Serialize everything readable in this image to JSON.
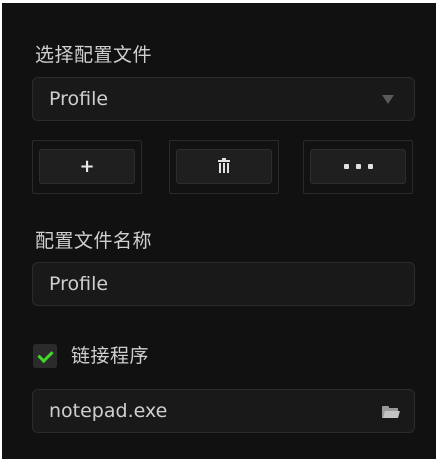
{
  "profile_section": {
    "label": "选择配置文件",
    "selected_profile": "Profile"
  },
  "profile_actions": {
    "add_label": "+",
    "delete_icon": "trash-icon",
    "more_icon": "ellipsis-icon"
  },
  "profile_name_section": {
    "label": "配置文件名称",
    "value": "Profile"
  },
  "link_program": {
    "label": "链接程序",
    "checked": true,
    "program_value": "notepad.exe",
    "browse_icon": "folder-icon"
  },
  "colors": {
    "panel_background": "#111111",
    "field_background": "#191919",
    "text": "#cfcfcf",
    "check_accent": "#44d62c"
  }
}
